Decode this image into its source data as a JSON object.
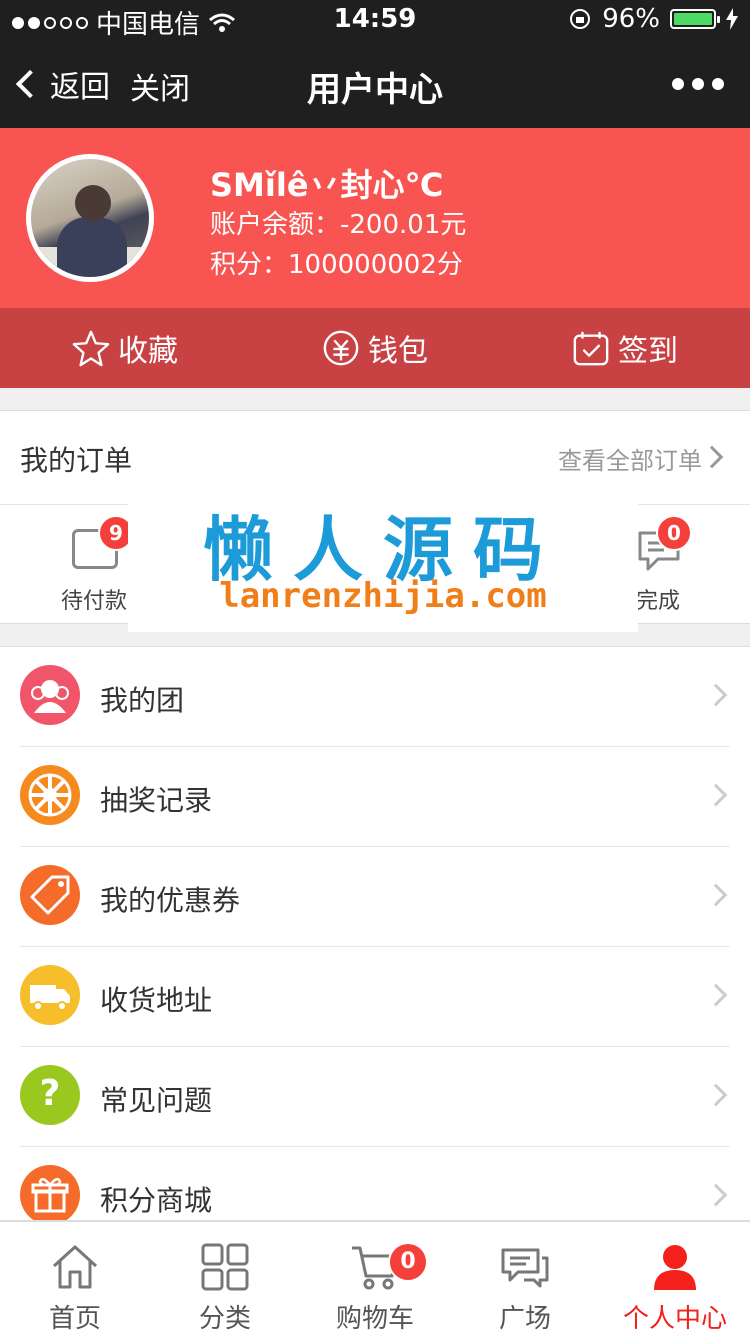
{
  "status_bar": {
    "carrier": "中国电信",
    "time": "14:59",
    "battery": "96%"
  },
  "nav": {
    "back_label": "返回",
    "close_label": "关闭",
    "title": "用户中心"
  },
  "profile": {
    "name": "SMǐlê丷封心℃",
    "balance": "账户余额：-200.01元",
    "points": "积分：100000002分"
  },
  "quick_actions": [
    {
      "label": "收藏",
      "icon": "star-icon"
    },
    {
      "label": "钱包",
      "icon": "wallet-icon"
    },
    {
      "label": "签到",
      "icon": "calendar-check-icon"
    }
  ],
  "orders": {
    "title": "我的订单",
    "view_all": "查看全部订单",
    "items": [
      {
        "label": "待付款",
        "badge": "9",
        "icon": "wallet-icon"
      },
      {
        "label": "完成",
        "badge": "0",
        "icon": "comment-icon"
      }
    ]
  },
  "watermark": {
    "cn": "懒人源码",
    "en": "lanrenzhijia.com"
  },
  "menu": [
    {
      "label": "我的团",
      "icon": "group-icon",
      "color": "#f0556a"
    },
    {
      "label": "抽奖记录",
      "icon": "lottery-wheel-icon",
      "color": "#f58a1f"
    },
    {
      "label": "我的优惠券",
      "icon": "coupon-tag-icon",
      "color": "#f46b2a"
    },
    {
      "label": "收货地址",
      "icon": "truck-icon",
      "color": "#f6be2a"
    },
    {
      "label": "常见问题",
      "icon": "question-icon",
      "color": "#9bc81e"
    },
    {
      "label": "积分商城",
      "icon": "gift-icon",
      "color": "#f46b2a"
    }
  ],
  "tabs": [
    {
      "label": "首页",
      "icon": "home-icon"
    },
    {
      "label": "分类",
      "icon": "grid-icon"
    },
    {
      "label": "购物车",
      "icon": "cart-icon",
      "badge": "0"
    },
    {
      "label": "广场",
      "icon": "chat-icon"
    },
    {
      "label": "个人中心",
      "icon": "user-icon",
      "active": true
    }
  ],
  "colors": {
    "header_red": "#f85552",
    "quick_red": "#c84244",
    "active_tab": "#f4201c",
    "badge_red": "#f43f3b"
  }
}
